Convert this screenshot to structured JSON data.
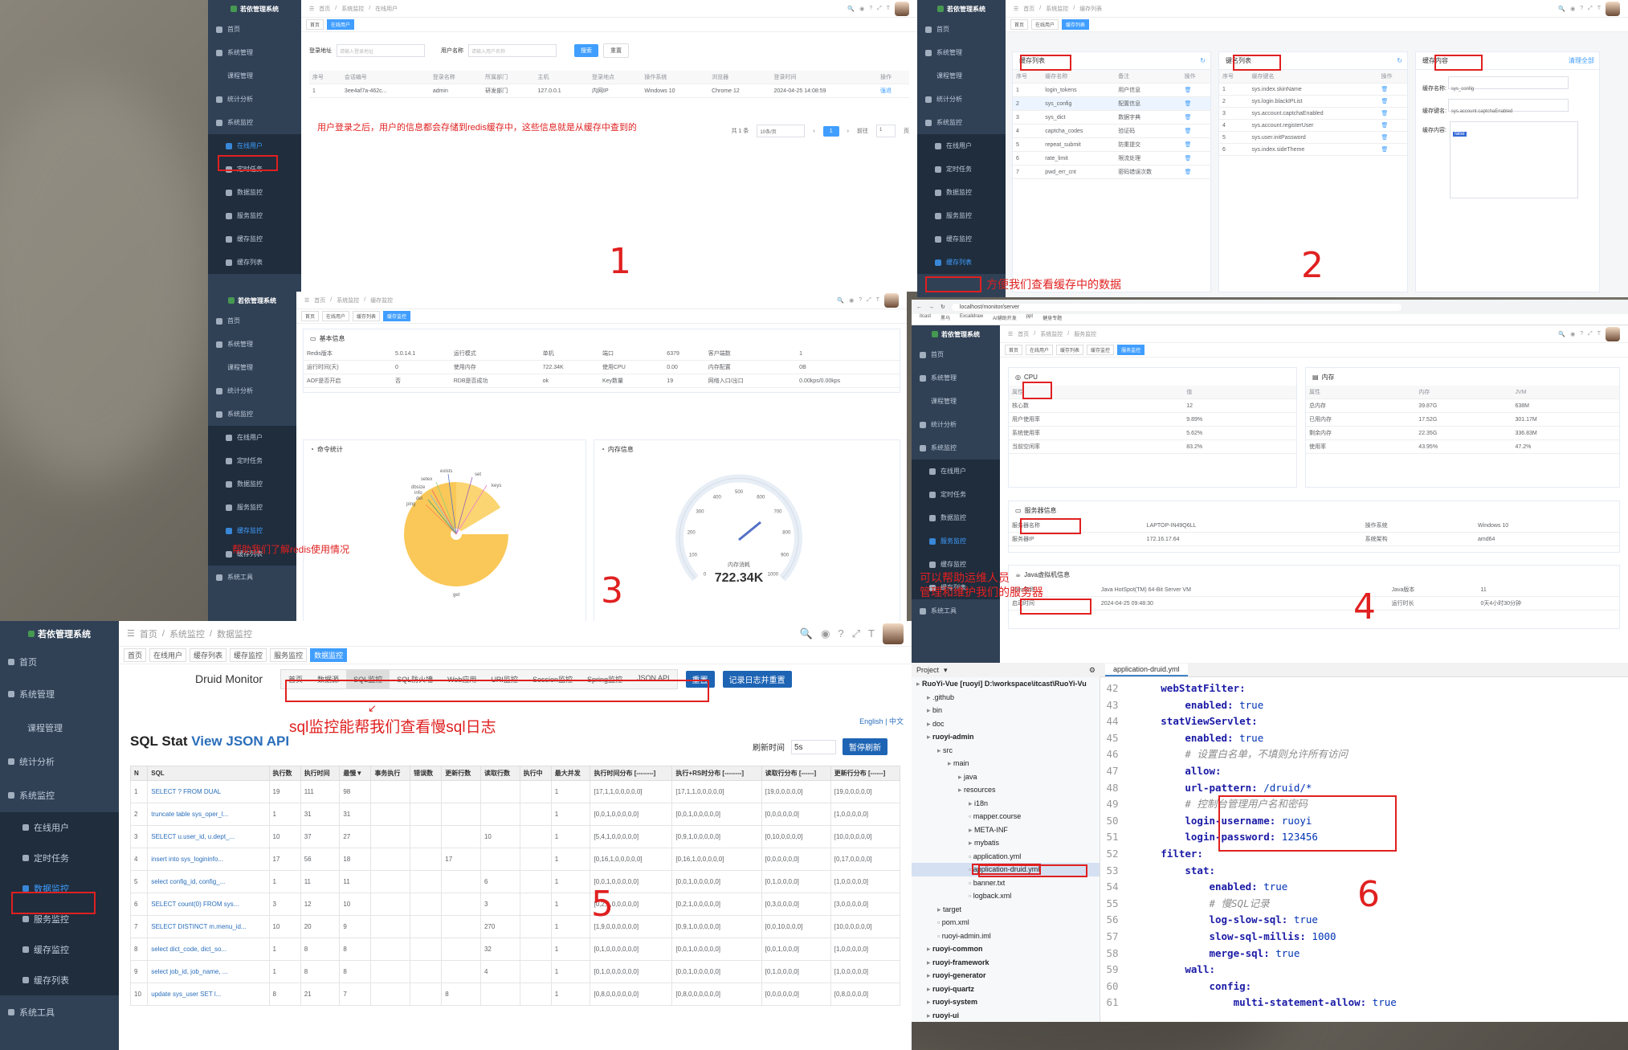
{
  "app_name": "若依管理系统",
  "numbers": [
    "1",
    "2",
    "3",
    "4",
    "5",
    "6"
  ],
  "sidebar": {
    "home": "首页",
    "sys_manage": "系统管理",
    "course": "课程管理",
    "stats": "统计分析",
    "monitor": "系统监控",
    "online": "在线用户",
    "job": "定时任务",
    "data": "数据监控",
    "server": "服务监控",
    "cache": "缓存监控",
    "cache_list": "缓存列表",
    "tools": "系统工具"
  },
  "p1": {
    "breadcrumb": [
      "首页",
      "系统监控",
      "在线用户"
    ],
    "tags": [
      "首页",
      "在线用户"
    ],
    "login_addr_label": "登录地址",
    "login_addr_ph": "请输入登录地址",
    "username_label": "用户名称",
    "username_ph": "请输入用户名称",
    "search": "搜索",
    "reset": "重置",
    "cols": [
      "序号",
      "会话编号",
      "登录名称",
      "所属部门",
      "主机",
      "登录地点",
      "操作系统",
      "浏览器",
      "登录时间",
      "操作"
    ],
    "row": [
      "1",
      "3ee4af7a-462c...",
      "admin",
      "研发部门",
      "127.0.0.1",
      "内网IP",
      "Windows 10",
      "Chrome 12",
      "2024-04-25 14:08:59",
      "强退"
    ],
    "note": "用户登录之后，用户的信息都会存储到redis缓存中，这些信息就是从缓存中查到的",
    "pager": {
      "total": "共 1 条",
      "size": "10条/页",
      "page": "1",
      "goto": "前往",
      "goto_page": "1",
      "unit": "页"
    }
  },
  "p2": {
    "breadcrumb": [
      "首页",
      "系统监控",
      "缓存列表"
    ],
    "tags": [
      "首页",
      "在线用户",
      "缓存列表"
    ],
    "cache_list_title": "缓存列表",
    "key_list_title": "键名列表",
    "cache_content_title": "缓存内容",
    "clear_all": "清理全部",
    "cache_cols": [
      "序号",
      "缓存名称",
      "备注",
      "操作"
    ],
    "cache_rows": [
      [
        "1",
        "login_tokens",
        "用户信息"
      ],
      [
        "2",
        "sys_config",
        "配置信息"
      ],
      [
        "3",
        "sys_dict",
        "数据字典"
      ],
      [
        "4",
        "captcha_codes",
        "验证码"
      ],
      [
        "5",
        "repeat_submit",
        "防重提交"
      ],
      [
        "6",
        "rate_limit",
        "限流处理"
      ],
      [
        "7",
        "pwd_err_cnt",
        "密码错误次数"
      ]
    ],
    "key_cols": [
      "序号",
      "缓存键名",
      "操作"
    ],
    "key_rows": [
      [
        "1",
        "sys.index.skinName"
      ],
      [
        "2",
        "sys.login.blackIPList"
      ],
      [
        "3",
        "sys.account.captchaEnabled"
      ],
      [
        "4",
        "sys.account.registerUser"
      ],
      [
        "5",
        "sys.user.initPassword"
      ],
      [
        "6",
        "sys.index.sideTheme"
      ]
    ],
    "content": {
      "name_label": "缓存名称:",
      "name": "sys_config",
      "key_label": "缓存键名:",
      "key": "sys.account.captchaEnabled",
      "val_label": "缓存内容:",
      "val": "false"
    },
    "note": "方便我们查看缓存中的数据"
  },
  "p3": {
    "breadcrumb": [
      "首页",
      "系统监控",
      "缓存监控"
    ],
    "tags": [
      "首页",
      "在线用户",
      "缓存列表",
      "缓存监控"
    ],
    "basic_title": "基本信息",
    "basic": [
      [
        "Redis版本",
        "5.0.14.1",
        "运行模式",
        "单机",
        "端口",
        "6379",
        "客户端数",
        "1"
      ],
      [
        "运行时间(天)",
        "0",
        "使用内存",
        "722.34K",
        "使用CPU",
        "0.00",
        "内存配置",
        "0B"
      ],
      [
        "AOF是否开启",
        "否",
        "RDB是否成功",
        "ok",
        "Key数量",
        "19",
        "网络入口/出口",
        "0.00kps/0.00kps"
      ]
    ],
    "cmd_title": "命令统计",
    "mem_title": "内存信息",
    "pie_labels": [
      "exists",
      "setex",
      "dbsize",
      "info",
      "del",
      "ping",
      "set",
      "keys",
      "get"
    ],
    "gauge_label": "内存消耗",
    "gauge_value": "722.34K",
    "gauge_ticks": [
      "0",
      "100",
      "200",
      "300",
      "400",
      "500",
      "600",
      "700",
      "800",
      "900",
      "1000"
    ],
    "note": "帮助我们了解redis使用情况"
  },
  "p4": {
    "url": "localhost/monitor/server",
    "bookmarks": [
      "itcast",
      "黑马",
      "Excalidraw",
      "AI辅助开发",
      "ppt",
      "健身专题"
    ],
    "breadcrumb": [
      "首页",
      "系统监控",
      "服务监控"
    ],
    "tags": [
      "首页",
      "在线用户",
      "缓存列表",
      "缓存监控",
      "服务监控"
    ],
    "cpu_title": "CPU",
    "cpu_cols": [
      "属性",
      "值"
    ],
    "cpu_rows": [
      [
        "核心数",
        "12"
      ],
      [
        "用户使用率",
        "9.89%"
      ],
      [
        "系统使用率",
        "5.62%"
      ],
      [
        "当前空闲率",
        "83.2%"
      ]
    ],
    "mem_title": "内存",
    "mem_cols": [
      "属性",
      "内存",
      "JVM"
    ],
    "mem_rows": [
      [
        "总内存",
        "39.87G",
        "638M"
      ],
      [
        "已用内存",
        "17.52G",
        "301.17M"
      ],
      [
        "剩余内存",
        "22.35G",
        "336.83M"
      ],
      [
        "使用率",
        "43.95%",
        "47.2%"
      ]
    ],
    "server_title": "服务器信息",
    "server_rows": [
      [
        "服务器名称",
        "LAPTOP-IN49Q6LL",
        "操作系统",
        "Windows 10"
      ],
      [
        "服务器IP",
        "172.16.17.64",
        "系统架构",
        "amd64"
      ]
    ],
    "jvm_title": "Java虚拟机信息",
    "jvm_rows": [
      [
        "Java名称",
        "Java HotSpot(TM) 64-Bit Server VM",
        "Java版本",
        "11"
      ],
      [
        "启动时间",
        "2024-04-25 09:48:30",
        "运行时长",
        "0天4小时30分钟"
      ]
    ],
    "note_line1": "可以帮助运维人员",
    "note_line2": "管理和维护我们的服务器"
  },
  "p5": {
    "breadcrumb": [
      "首页",
      "系统监控",
      "数据监控"
    ],
    "tags": [
      "首页",
      "在线用户",
      "缓存列表",
      "缓存监控",
      "服务监控",
      "数据监控"
    ],
    "druid_title": "Druid Monitor",
    "druid_tabs": [
      "首页",
      "数据源",
      "SQL监控",
      "SQL防火墙",
      "Web应用",
      "URI监控",
      "Session监控",
      "Spring监控",
      "JSON API"
    ],
    "reset": "重置",
    "reset_log": "记录日志并重置",
    "lang": "English | 中文",
    "stat_title": "SQL Stat",
    "stat_link": "View JSON API",
    "refresh_label": "刷新时间",
    "refresh_val": "5s",
    "stop": "暂停刷新",
    "cols": [
      "N",
      "SQL",
      "执行数",
      "执行时间",
      "最慢▼",
      "事务执行",
      "错误数",
      "更新行数",
      "读取行数",
      "执行中",
      "最大并发",
      "执行时间分布 [--------]",
      "执行+RS时分布 [--------]",
      "读取行分布 [------]",
      "更新行分布 [------]"
    ],
    "rows": [
      [
        "1",
        "SELECT ? FROM DUAL",
        "19",
        "111",
        "98",
        "",
        "",
        "",
        "",
        "",
        "1",
        "[17,1,1,0,0,0,0,0]",
        "[17,1,1,0,0,0,0,0]",
        "[19,0,0,0,0,0]",
        "[19,0,0,0,0,0]"
      ],
      [
        "2",
        "truncate table sys_oper_l...",
        "1",
        "31",
        "31",
        "",
        "",
        "",
        "",
        "",
        "1",
        "[0,0,1,0,0,0,0,0]",
        "[0,0,1,0,0,0,0,0]",
        "[0,0,0,0,0,0]",
        "[1,0,0,0,0,0]"
      ],
      [
        "3",
        "SELECT u.user_id, u.dept_...",
        "10",
        "37",
        "27",
        "",
        "",
        "",
        "10",
        "",
        "1",
        "[5,4,1,0,0,0,0,0]",
        "[0,9,1,0,0,0,0,0]",
        "[0,10,0,0,0,0]",
        "[10,0,0,0,0,0]"
      ],
      [
        "4",
        "insert into sys_logininfo...",
        "17",
        "56",
        "18",
        "",
        "",
        "17",
        "",
        "",
        "1",
        "[0,16,1,0,0,0,0,0]",
        "[0,16,1,0,0,0,0,0]",
        "[0,0,0,0,0,0]",
        "[0,17,0,0,0,0]"
      ],
      [
        "5",
        "select config_id, config_...",
        "1",
        "11",
        "11",
        "",
        "",
        "",
        "6",
        "",
        "1",
        "[0,0,1,0,0,0,0,0]",
        "[0,0,1,0,0,0,0,0]",
        "[0,1,0,0,0,0]",
        "[1,0,0,0,0,0]"
      ],
      [
        "6",
        "SELECT count(0) FROM sys...",
        "3",
        "12",
        "10",
        "",
        "",
        "",
        "3",
        "",
        "1",
        "[0,2,1,0,0,0,0,0]",
        "[0,2,1,0,0,0,0,0]",
        "[0,3,0,0,0,0]",
        "[3,0,0,0,0,0]"
      ],
      [
        "7",
        "SELECT DISTINCT m.menu_id...",
        "10",
        "20",
        "9",
        "",
        "",
        "",
        "270",
        "",
        "1",
        "[1,9,0,0,0,0,0,0]",
        "[0,9,1,0,0,0,0,0]",
        "[0,0,10,0,0,0]",
        "[10,0,0,0,0,0]"
      ],
      [
        "8",
        "select dict_code, dict_so...",
        "1",
        "8",
        "8",
        "",
        "",
        "",
        "32",
        "",
        "1",
        "[0,1,0,0,0,0,0,0]",
        "[0,0,1,0,0,0,0,0]",
        "[0,0,1,0,0,0]",
        "[1,0,0,0,0,0]"
      ],
      [
        "9",
        "select job_id, job_name, ...",
        "1",
        "8",
        "8",
        "",
        "",
        "",
        "4",
        "",
        "1",
        "[0,1,0,0,0,0,0,0]",
        "[0,0,1,0,0,0,0,0]",
        "[0,1,0,0,0,0]",
        "[1,0,0,0,0,0]"
      ],
      [
        "10",
        "update sys_user SET l...",
        "8",
        "21",
        "7",
        "",
        "",
        "8",
        "",
        "",
        "1",
        "[0,8,0,0,0,0,0,0]",
        "[0,8,0,0,0,0,0,0]",
        "[0,0,0,0,0,0]",
        "[0,8,0,0,0,0]"
      ]
    ],
    "note": "sql监控能帮我们查看慢sql日志"
  },
  "p6": {
    "project_label": "Project",
    "tab_file": "application-druid.yml",
    "tree": [
      {
        "t": "RuoYi-Vue [ruoyi]  D:\\workspace\\itcast\\RuoYi-Vu",
        "d": 0,
        "b": true
      },
      {
        "t": ".github",
        "d": 1
      },
      {
        "t": "bin",
        "d": 1
      },
      {
        "t": "doc",
        "d": 1
      },
      {
        "t": "ruoyi-admin",
        "d": 1,
        "b": true
      },
      {
        "t": "src",
        "d": 2
      },
      {
        "t": "main",
        "d": 3
      },
      {
        "t": "java",
        "d": 4
      },
      {
        "t": "resources",
        "d": 4
      },
      {
        "t": "i18n",
        "d": 5
      },
      {
        "t": "mapper.course",
        "d": 5
      },
      {
        "t": "META-INF",
        "d": 5
      },
      {
        "t": "mybatis",
        "d": 5
      },
      {
        "t": "application.yml",
        "d": 5
      },
      {
        "t": "application-druid.yml",
        "d": 5,
        "sel": true
      },
      {
        "t": "banner.txt",
        "d": 5
      },
      {
        "t": "logback.xml",
        "d": 5
      },
      {
        "t": "target",
        "d": 2
      },
      {
        "t": "pom.xml",
        "d": 2
      },
      {
        "t": "ruoyi-admin.iml",
        "d": 2
      },
      {
        "t": "ruoyi-common",
        "d": 1,
        "b": true
      },
      {
        "t": "ruoyi-framework",
        "d": 1,
        "b": true
      },
      {
        "t": "ruoyi-generator",
        "d": 1,
        "b": true
      },
      {
        "t": "ruoyi-quartz",
        "d": 1,
        "b": true
      },
      {
        "t": "ruoyi-system",
        "d": 1,
        "b": true
      },
      {
        "t": "ruoyi-ui",
        "d": 1,
        "b": true
      }
    ],
    "code": [
      {
        "n": "42",
        "i": "    ",
        "k": "webStatFilter:",
        "v": "",
        "c": ""
      },
      {
        "n": "43",
        "i": "        ",
        "k": "enabled:",
        "v": " true",
        "c": ""
      },
      {
        "n": "44",
        "i": "    ",
        "k": "statViewServlet:",
        "v": "",
        "c": ""
      },
      {
        "n": "45",
        "i": "        ",
        "k": "enabled:",
        "v": " true",
        "c": ""
      },
      {
        "n": "46",
        "i": "        ",
        "k": "",
        "v": "",
        "c": "# 设置白名单，不填则允许所有访问"
      },
      {
        "n": "47",
        "i": "        ",
        "k": "allow:",
        "v": "",
        "c": ""
      },
      {
        "n": "48",
        "i": "        ",
        "k": "url-pattern:",
        "v": " /druid/*",
        "c": ""
      },
      {
        "n": "49",
        "i": "        ",
        "k": "",
        "v": "",
        "c": "# 控制台管理用户名和密码"
      },
      {
        "n": "50",
        "i": "        ",
        "k": "login-username:",
        "v": " ruoyi",
        "c": ""
      },
      {
        "n": "51",
        "i": "        ",
        "k": "login-password:",
        "v": " 123456",
        "c": ""
      },
      {
        "n": "52",
        "i": "    ",
        "k": "filter:",
        "v": "",
        "c": ""
      },
      {
        "n": "53",
        "i": "        ",
        "k": "stat:",
        "v": "",
        "c": ""
      },
      {
        "n": "54",
        "i": "            ",
        "k": "enabled:",
        "v": " true",
        "c": ""
      },
      {
        "n": "55",
        "i": "            ",
        "k": "",
        "v": "",
        "c": "# 慢SQL记录"
      },
      {
        "n": "56",
        "i": "            ",
        "k": "log-slow-sql:",
        "v": " true",
        "c": ""
      },
      {
        "n": "57",
        "i": "            ",
        "k": "slow-sql-millis:",
        "v": " 1000",
        "c": ""
      },
      {
        "n": "58",
        "i": "            ",
        "k": "merge-sql:",
        "v": " true",
        "c": ""
      },
      {
        "n": "59",
        "i": "        ",
        "k": "wall:",
        "v": "",
        "c": ""
      },
      {
        "n": "60",
        "i": "            ",
        "k": "config:",
        "v": "",
        "c": ""
      },
      {
        "n": "61",
        "i": "                ",
        "k": "multi-statement-allow:",
        "v": " true",
        "c": ""
      }
    ]
  }
}
